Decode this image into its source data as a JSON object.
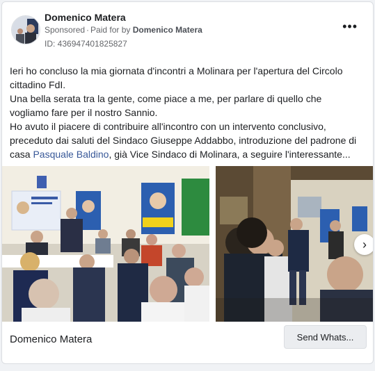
{
  "post": {
    "page_name": "Domenico Matera",
    "sponsored_label": "Sponsored",
    "paid_for_prefix": "Paid for by",
    "paid_for_name": "Domenico Matera",
    "ad_id": "ID: 436947401825827",
    "more_icon": "more-horizontal-icon"
  },
  "body": {
    "line1": "Ieri ho concluso la mia giornata d'incontri a Molinara per l'apertura del Circolo cittadino FdI.",
    "line2": "Una bella serata tra la gente, come piace a me, per parlare di quello che vogliamo fare per il nostro Sannio.",
    "line3_before": "Ho avuto il piacere di contribuire all'incontro con un intervento conclusivo, preceduto dai saluti del Sindaco Giuseppe Addabbo, introduzione del padrone di casa ",
    "line3_link": "Pasquale Baldino",
    "line3_after": ", già Vice Sindaco di Molinara, a seguire l'interessante..."
  },
  "footer": {
    "name": "Domenico Matera",
    "cta_label": "Send Whats..."
  },
  "colors": {
    "link": "#385898",
    "cta_bg": "#ebedf0",
    "card_border": "#dadde1"
  }
}
